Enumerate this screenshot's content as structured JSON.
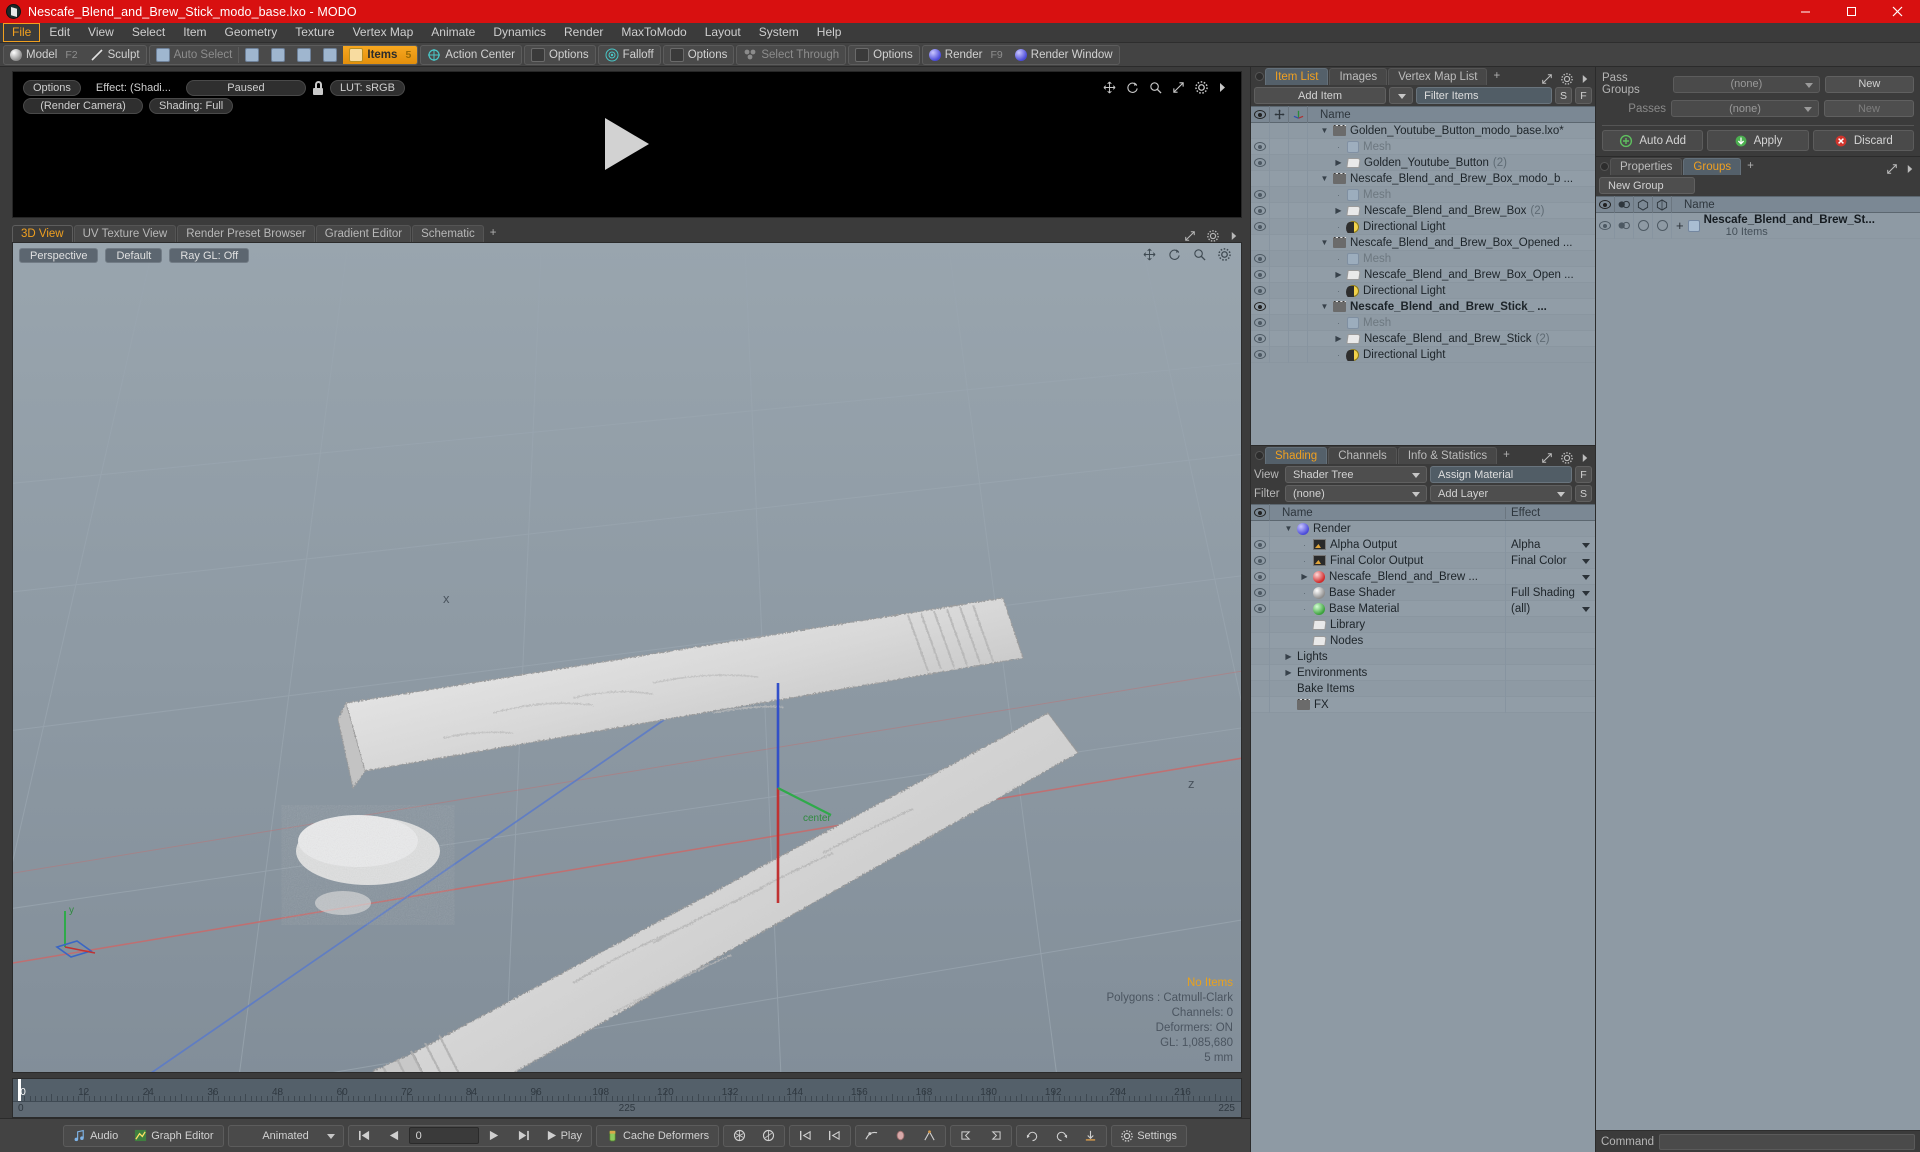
{
  "window": {
    "title": "Nescafe_Blend_and_Brew_Stick_modo_base.lxo - MODO",
    "minimize": "–",
    "maximize": "▢",
    "close": "✕"
  },
  "menubar": {
    "items": [
      "File",
      "Edit",
      "View",
      "Select",
      "Item",
      "Geometry",
      "Texture",
      "Vertex Map",
      "Animate",
      "Dynamics",
      "Render",
      "MaxToModo",
      "Layout",
      "System",
      "Help"
    ],
    "active": "File"
  },
  "toolbar": {
    "mode_model": "Model",
    "mode_model_hotkey": "F2",
    "mode_sculpt": "Sculpt",
    "auto_select": "Auto Select",
    "items": "Items",
    "items_hotkey": "5",
    "action_center": "Action Center",
    "options1": "Options",
    "falloff": "Falloff",
    "options2": "Options",
    "select_through": "Select Through",
    "options3": "Options",
    "render": "Render",
    "render_hotkey": "F9",
    "render_window": "Render Window"
  },
  "render_preview": {
    "options": "Options",
    "effect": "Effect: (Shadi...",
    "state": "Paused",
    "lut": "LUT: sRGB",
    "camera": "(Render Camera)",
    "shading": "Shading: Full"
  },
  "viewport": {
    "tabs": [
      {
        "label": "3D View",
        "active": true
      },
      {
        "label": "UV Texture View",
        "active": false
      },
      {
        "label": "Render Preset Browser",
        "active": false
      },
      {
        "label": "Gradient Editor",
        "active": false
      },
      {
        "label": "Schematic",
        "active": false
      }
    ],
    "add_tab": "+",
    "buttons": [
      "Perspective",
      "Default",
      "Ray GL: Off"
    ],
    "stats": {
      "selection": "No Items",
      "polygons": "Polygons : Catmull-Clark",
      "channels": "Channels: 0",
      "deformers": "Deformers: ON",
      "gl": "GL: 1,085,680",
      "scale": "5 mm"
    },
    "axis_labels": {
      "x": "x",
      "y": "y",
      "z": "z"
    }
  },
  "timeline": {
    "ticks": [
      0,
      12,
      24,
      36,
      48,
      60,
      72,
      84,
      96,
      108,
      120,
      132,
      144,
      156,
      168,
      180,
      192,
      204,
      216
    ],
    "range_start": "0",
    "range_mid": "225",
    "range_end": "225",
    "playhead_frame": 0
  },
  "bottombar": {
    "audio": "Audio",
    "graph_editor": "Graph Editor",
    "mode": "Animated",
    "frame_value": "0",
    "play": "Play",
    "cache_deformers": "Cache Deformers",
    "settings": "Settings"
  },
  "item_list": {
    "tabs": [
      {
        "label": "Item List",
        "active": true
      },
      {
        "label": "Images",
        "active": false
      },
      {
        "label": "Vertex Map List",
        "active": false
      }
    ],
    "add_tab": "+",
    "add_item": "Add Item",
    "filter_placeholder": "Filter Items",
    "btn_s": "S",
    "btn_f": "F",
    "col_name": "Name",
    "rows": [
      {
        "indent": 0,
        "caret": "▼",
        "icon": "clapper-icon",
        "label": "Golden_Youtube_Button_modo_base.lxo*",
        "count": "",
        "eye": false,
        "bold": false,
        "dim": false
      },
      {
        "indent": 1,
        "caret": "·",
        "icon": "mesh-icon",
        "label": "Mesh",
        "count": "",
        "eye": true,
        "bold": false,
        "dim": true
      },
      {
        "indent": 1,
        "caret": "▶",
        "icon": "folder-icon",
        "label": "Golden_Youtube_Button",
        "count": "(2)",
        "eye": true,
        "bold": false,
        "dim": false
      },
      {
        "indent": 0,
        "caret": "▼",
        "icon": "clapper-icon",
        "label": "Nescafe_Blend_and_Brew_Box_modo_b ...",
        "count": "",
        "eye": false,
        "bold": false,
        "dim": false
      },
      {
        "indent": 1,
        "caret": "·",
        "icon": "mesh-icon",
        "label": "Mesh",
        "count": "",
        "eye": true,
        "bold": false,
        "dim": true
      },
      {
        "indent": 1,
        "caret": "▶",
        "icon": "folder-icon",
        "label": "Nescafe_Blend_and_Brew_Box",
        "count": "(2)",
        "eye": true,
        "bold": false,
        "dim": false
      },
      {
        "indent": 1,
        "caret": "·",
        "icon": "light-icon",
        "label": "Directional Light",
        "count": "",
        "eye": true,
        "bold": false,
        "dim": false
      },
      {
        "indent": 0,
        "caret": "▼",
        "icon": "clapper-icon",
        "label": "Nescafe_Blend_and_Brew_Box_Opened ...",
        "count": "",
        "eye": false,
        "bold": false,
        "dim": false
      },
      {
        "indent": 1,
        "caret": "·",
        "icon": "mesh-icon",
        "label": "Mesh",
        "count": "",
        "eye": true,
        "bold": false,
        "dim": true
      },
      {
        "indent": 1,
        "caret": "▶",
        "icon": "folder-icon",
        "label": "Nescafe_Blend_and_Brew_Box_Open ...",
        "count": "",
        "eye": true,
        "bold": false,
        "dim": false
      },
      {
        "indent": 1,
        "caret": "·",
        "icon": "light-icon",
        "label": "Directional Light",
        "count": "",
        "eye": true,
        "bold": false,
        "dim": false
      },
      {
        "indent": 0,
        "caret": "▼",
        "icon": "clapper-icon",
        "label": "Nescafe_Blend_and_Brew_Stick_  ...",
        "count": "",
        "eye": true,
        "bold": true,
        "dim": false
      },
      {
        "indent": 1,
        "caret": "·",
        "icon": "mesh-icon",
        "label": "Mesh",
        "count": "",
        "eye": true,
        "bold": false,
        "dim": true
      },
      {
        "indent": 1,
        "caret": "▶",
        "icon": "folder-icon",
        "label": "Nescafe_Blend_and_Brew_Stick",
        "count": "(2)",
        "eye": true,
        "bold": false,
        "dim": false
      },
      {
        "indent": 1,
        "caret": "·",
        "icon": "light-icon",
        "label": "Directional Light",
        "count": "",
        "eye": true,
        "bold": false,
        "dim": false
      }
    ]
  },
  "shading": {
    "tabs": [
      {
        "label": "Shading",
        "active": true
      },
      {
        "label": "Channels",
        "active": false
      },
      {
        "label": "Info & Statistics",
        "active": false
      }
    ],
    "add_tab": "+",
    "view_label": "View",
    "view_value": "Shader Tree",
    "assign_material": "Assign Material",
    "btn_f": "F",
    "filter_label": "Filter",
    "filter_value": "(none)",
    "add_layer": "Add Layer",
    "btn_s": "S",
    "col_name": "Name",
    "col_effect": "Effect",
    "rows": [
      {
        "indent": 0,
        "caret": "▼",
        "icon": "sphere-blue-icon",
        "label": "Render",
        "effect": "",
        "eye": false,
        "arrow": false
      },
      {
        "indent": 1,
        "caret": "·",
        "icon": "image-icon",
        "label": "Alpha Output",
        "effect": "Alpha",
        "eye": true,
        "arrow": true
      },
      {
        "indent": 1,
        "caret": "·",
        "icon": "image-icon",
        "label": "Final Color Output",
        "effect": "Final Color",
        "eye": true,
        "arrow": true
      },
      {
        "indent": 1,
        "caret": "▶",
        "icon": "sphere-red-icon",
        "label": "Nescafe_Blend_and_Brew ...",
        "effect": "",
        "eye": true,
        "arrow": true
      },
      {
        "indent": 1,
        "caret": "·",
        "icon": "sphere-white-icon",
        "label": "Base Shader",
        "effect": "Full Shading",
        "eye": true,
        "arrow": true
      },
      {
        "indent": 1,
        "caret": "·",
        "icon": "sphere-green-icon",
        "label": "Base Material",
        "effect": "(all)",
        "eye": true,
        "arrow": true
      },
      {
        "indent": 1,
        "caret": "",
        "icon": "folder-icon",
        "label": "Library",
        "effect": "",
        "eye": false,
        "arrow": false
      },
      {
        "indent": 1,
        "caret": "",
        "icon": "folder-icon",
        "label": "Nodes",
        "effect": "",
        "eye": false,
        "arrow": false
      },
      {
        "indent": 0,
        "caret": "▶",
        "icon": "none",
        "label": "Lights",
        "effect": "",
        "eye": false,
        "arrow": false
      },
      {
        "indent": 0,
        "caret": "▶",
        "icon": "none",
        "label": "Environments",
        "effect": "",
        "eye": false,
        "arrow": false
      },
      {
        "indent": 0,
        "caret": "",
        "icon": "none",
        "label": "Bake Items",
        "effect": "",
        "eye": false,
        "arrow": false
      },
      {
        "indent": 0,
        "caret": "",
        "icon": "clapper-icon",
        "label": "FX",
        "effect": "",
        "eye": false,
        "arrow": false
      }
    ]
  },
  "passes": {
    "pass_groups_label": "Pass Groups",
    "pass_groups_value": "(none)",
    "pass_groups_new": "New",
    "passes_label": "Passes",
    "passes_value": "(none)",
    "passes_new": "New",
    "auto_add": "Auto Add",
    "apply": "Apply",
    "discard": "Discard"
  },
  "groups": {
    "tabs": [
      {
        "label": "Properties",
        "active": false
      },
      {
        "label": "Groups",
        "active": true
      }
    ],
    "add_tab": "+",
    "new_group": "New Group",
    "col_name": "Name",
    "rows": [
      {
        "expand": "+",
        "label": "Nescafe_Blend_and_Brew_St...",
        "sub": "10 Items"
      }
    ]
  },
  "command": {
    "label": "Command"
  },
  "colors": {
    "title_bg": "#d81010",
    "accent": "#f0a020",
    "panel_bg": "#3b3b3b",
    "tree_bg": "#8e9aa4",
    "header_bg": "#7b8894"
  }
}
